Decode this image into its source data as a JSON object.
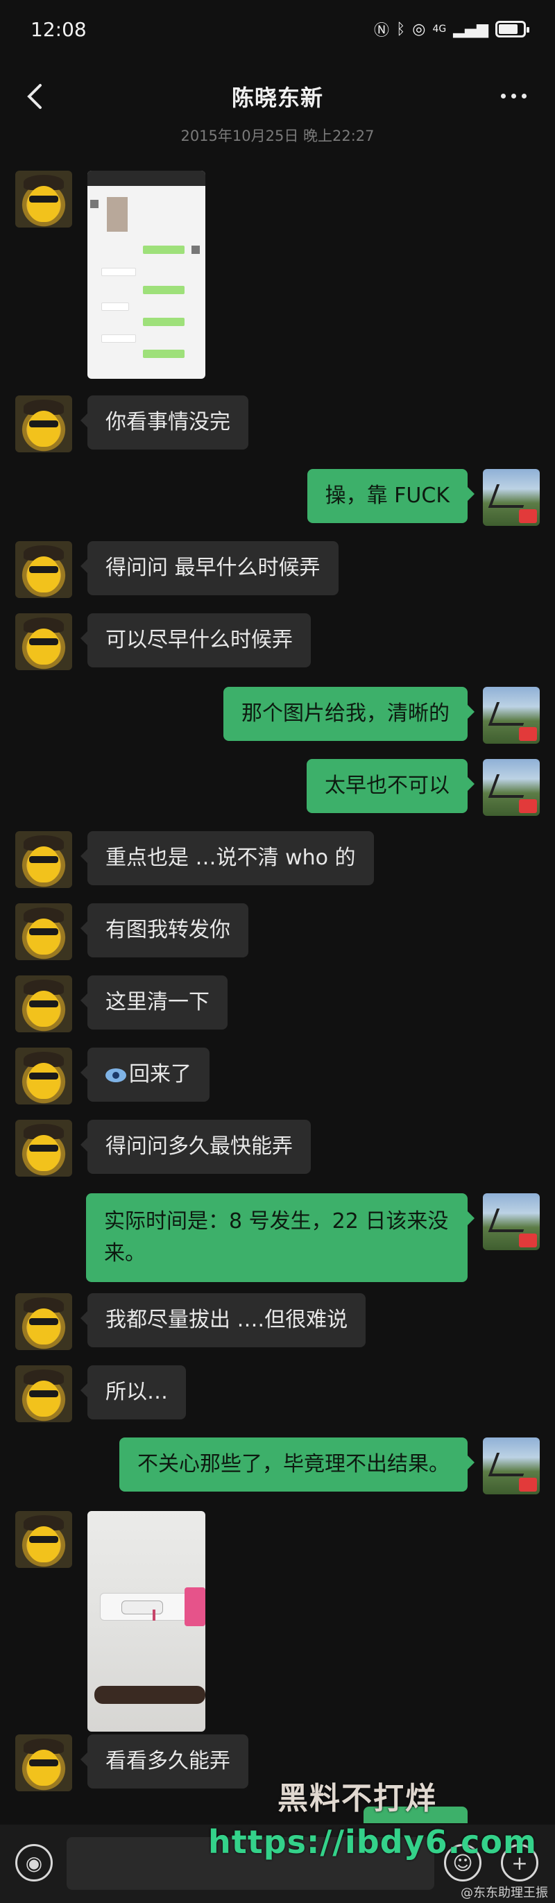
{
  "status_bar": {
    "time": "12:08",
    "icons": [
      "nfc-icon",
      "bluetooth-icon",
      "hotspot-icon",
      "signal-icon",
      "battery-icon"
    ],
    "network_label": "4G"
  },
  "header": {
    "title": "陈晓东新",
    "back_icon": "chevron-left-icon",
    "more_icon": "more-dots-icon"
  },
  "timestamp": "2015年10月25日  晚上22:27",
  "messages": [
    {
      "side": "left",
      "type": "image",
      "description_key": "chat-screenshot"
    },
    {
      "side": "left",
      "type": "text",
      "text": "你看事情没完"
    },
    {
      "side": "right",
      "type": "text",
      "text": "操，靠 FUCK"
    },
    {
      "side": "left",
      "type": "text",
      "text": "得问问  最早什么时候弄"
    },
    {
      "side": "left",
      "type": "text",
      "text": "可以尽早什么时候弄"
    },
    {
      "side": "right",
      "type": "text",
      "text": "那个图片给我，清晰的"
    },
    {
      "side": "right",
      "type": "text",
      "text": "太早也不可以"
    },
    {
      "side": "left",
      "type": "text",
      "text": "重点也是 …说不清    who  的"
    },
    {
      "side": "left",
      "type": "text",
      "text": "有图我转发你"
    },
    {
      "side": "left",
      "type": "text",
      "text": "这里清一下"
    },
    {
      "side": "left",
      "type": "text",
      "text": "回来了"
    },
    {
      "side": "left",
      "type": "text",
      "text": "得问问多久最快能弄"
    },
    {
      "side": "right",
      "type": "text",
      "text": "实际时间是：8 号发生，22 日该来没来。"
    },
    {
      "side": "left",
      "type": "text",
      "text": "我都尽量拔出  ….但很难说"
    },
    {
      "side": "left",
      "type": "text",
      "text": "所以…"
    },
    {
      "side": "right",
      "type": "text",
      "text": "不关心那些了，毕竟理不出结果。"
    },
    {
      "side": "left",
      "type": "image",
      "description_key": "photo"
    },
    {
      "side": "left",
      "type": "text",
      "text": "看看多久能弄"
    }
  ],
  "input_bar": {
    "voice_icon": "voice-icon",
    "emoji_icon": "emoji-icon",
    "plus_icon": "plus-icon"
  },
  "watermark": {
    "line1": "黑料不打烊",
    "line2": "https://ibdy6.com"
  },
  "credit": "@东东助理王振",
  "colors": {
    "background": "#111111",
    "bubble_left": "#2c2c2c",
    "bubble_right": "#3db06a"
  }
}
